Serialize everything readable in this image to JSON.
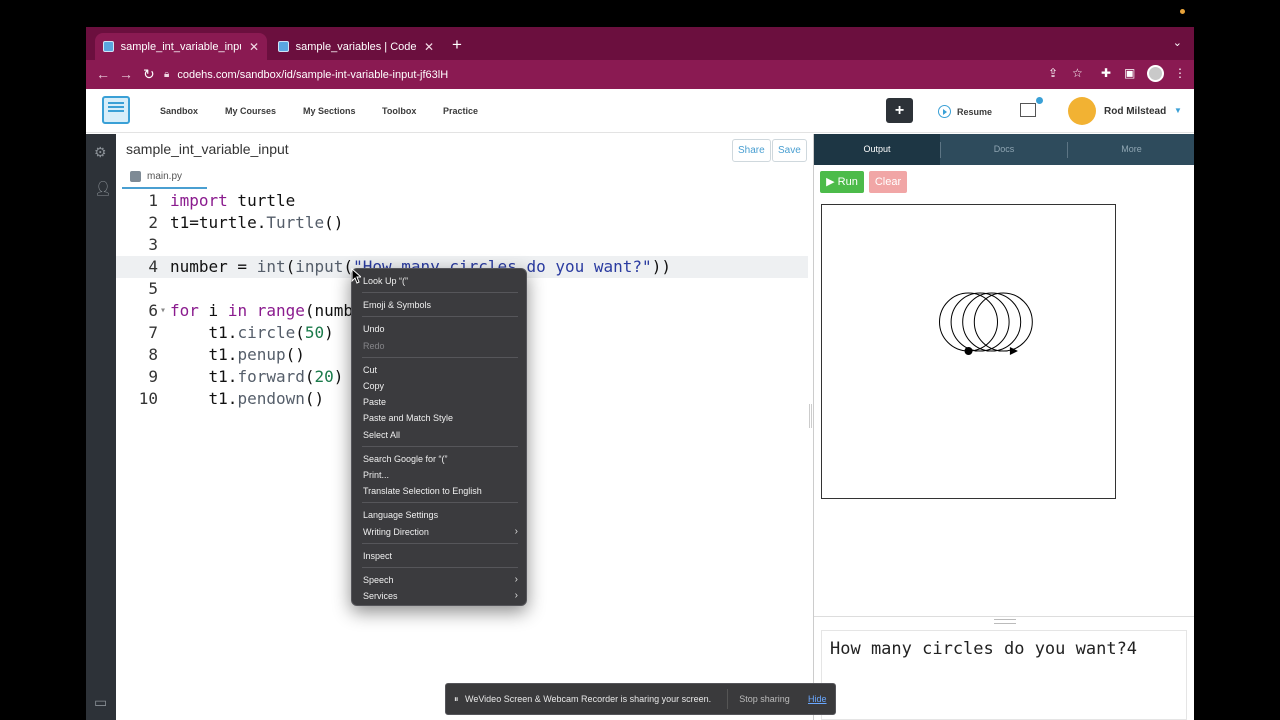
{
  "browser": {
    "tabs": [
      {
        "title": "sample_int_variable_input | C",
        "active": true
      },
      {
        "title": "sample_variables | CodeHS",
        "active": false
      }
    ],
    "url": "codehs.com/sandbox/id/sample-int-variable-input-jf63lH"
  },
  "appnav": {
    "links": [
      "Sandbox",
      "My Courses",
      "My Sections",
      "Toolbox",
      "Practice"
    ],
    "plus_label": "+",
    "resume_label": "Resume",
    "user_name": "Rod Milstead"
  },
  "editor": {
    "project_title": "sample_int_variable_input",
    "share_label": "Share",
    "save_label": "Save",
    "file_tab": "main.py",
    "lines": [
      {
        "n": "1",
        "text": "import turtle"
      },
      {
        "n": "2",
        "text": "t1=turtle.Turtle()"
      },
      {
        "n": "3",
        "text": ""
      },
      {
        "n": "4",
        "text": "number = int(input(\"How many circles do you want?\"))"
      },
      {
        "n": "5",
        "text": ""
      },
      {
        "n": "6",
        "text": "for i in range(numb"
      },
      {
        "n": "7",
        "text": "    t1.circle(50)"
      },
      {
        "n": "8",
        "text": "    t1.penup()"
      },
      {
        "n": "9",
        "text": "    t1.forward(20)"
      },
      {
        "n": "10",
        "text": "    t1.pendown()"
      }
    ]
  },
  "output_panel": {
    "tabs": [
      "Output",
      "Docs",
      "More"
    ],
    "run_label": "Run",
    "clear_label": "Clear",
    "console_text": "How many circles do you want?4"
  },
  "turtle_drawing": {
    "circle_count": 4,
    "radius": 50,
    "step": 20
  },
  "context_menu": {
    "groups": [
      [
        {
          "label": "Look Up “(”",
          "disabled": false
        }
      ],
      [
        {
          "label": "Emoji & Symbols",
          "disabled": false
        }
      ],
      [
        {
          "label": "Undo",
          "disabled": false
        },
        {
          "label": "Redo",
          "disabled": true
        }
      ],
      [
        {
          "label": "Cut",
          "disabled": false
        },
        {
          "label": "Copy",
          "disabled": false
        },
        {
          "label": "Paste",
          "disabled": false
        },
        {
          "label": "Paste and Match Style",
          "disabled": false
        },
        {
          "label": "Select All",
          "disabled": false
        }
      ],
      [
        {
          "label": "Search Google for “(”",
          "disabled": false
        },
        {
          "label": "Print...",
          "disabled": false
        },
        {
          "label": "Translate Selection to English",
          "disabled": false
        }
      ],
      [
        {
          "label": "Language Settings",
          "disabled": false
        },
        {
          "label": "Writing Direction",
          "disabled": false,
          "submenu": true
        }
      ],
      [
        {
          "label": "Inspect",
          "disabled": false
        }
      ],
      [
        {
          "label": "Speech",
          "disabled": false,
          "submenu": true
        },
        {
          "label": "Services",
          "disabled": false,
          "submenu": true
        }
      ]
    ]
  },
  "share_banner": {
    "pause_icon": "⏸",
    "text": "WeVideo Screen & Webcam Recorder is sharing your screen.",
    "stop_label": "Stop sharing",
    "hide_label": "Hide"
  },
  "colors": {
    "tabstrip": "#6b0f3e",
    "toolbar": "#8a1a52",
    "output_tabs": "#2e4b5c",
    "run": "#4cbb4a",
    "clear": "#f1a6a6"
  }
}
